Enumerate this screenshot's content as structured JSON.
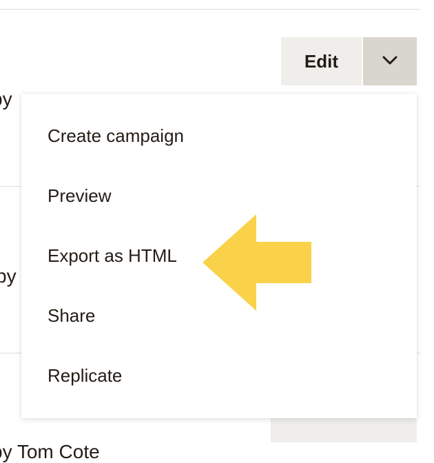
{
  "toolbar": {
    "edit_label": "Edit"
  },
  "background": {
    "row1_text": "by",
    "row2_text": "by",
    "row3_text": "by Tom Cote"
  },
  "dropdown": {
    "items": [
      {
        "label": "Create campaign"
      },
      {
        "label": "Preview"
      },
      {
        "label": "Export as HTML"
      },
      {
        "label": "Share"
      },
      {
        "label": "Replicate"
      }
    ]
  },
  "highlight": {
    "arrow_color": "#f9d24a"
  }
}
